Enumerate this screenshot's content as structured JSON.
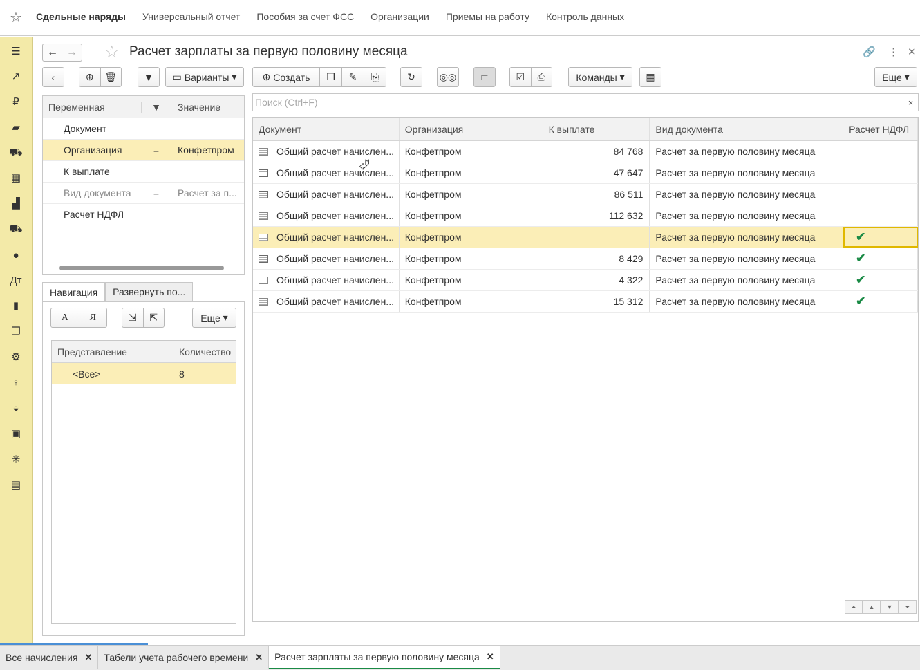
{
  "topnav": {
    "items": [
      "Сдельные наряды",
      "Универсальный отчет",
      "Пособия за счет ФСС",
      "Организации",
      "Приемы на работу",
      "Контроль данных"
    ]
  },
  "window": {
    "title": "Расчет зарплаты за первую половину месяца"
  },
  "toolbar": {
    "variants": "Варианты",
    "create": "Создать",
    "commands": "Команды",
    "more": "Еще"
  },
  "filter_panel": {
    "headers": [
      "Переменная",
      "Значение"
    ],
    "rows": [
      {
        "name": "Документ",
        "op": "",
        "value": ""
      },
      {
        "name": "Организация",
        "op": "=",
        "value": "Конфетпром"
      },
      {
        "name": "К выплате",
        "op": "",
        "value": ""
      },
      {
        "name": "Вид документа",
        "op": "=",
        "value": "Расчет за п..."
      },
      {
        "name": "Расчет НДФЛ",
        "op": "",
        "value": ""
      }
    ]
  },
  "tabs": {
    "nav": "Навигация",
    "expand": "Развернуть по..."
  },
  "nav_panel": {
    "a": "А",
    "ya": "Я",
    "more": "Еще",
    "headers": [
      "Представление",
      "Количество"
    ],
    "row": {
      "name": "<Все>",
      "count": "8"
    }
  },
  "search": {
    "placeholder": "Поиск (Ctrl+F)",
    "clear": "×"
  },
  "grid": {
    "headers": [
      "Документ",
      "Организация",
      "К выплате",
      "Вид документа",
      "Расчет НДФЛ"
    ],
    "rows": [
      {
        "doc": "Общий расчет начислен...",
        "org": "Конфетпром",
        "pay": "84 768",
        "kind": "Расчет за первую половину месяца",
        "ndfl": "",
        "posted": false
      },
      {
        "doc": "Общий расчет начислен...",
        "org": "Конфетпром",
        "pay": "47 647",
        "kind": "Расчет за первую половину месяца",
        "ndfl": "",
        "posted": true
      },
      {
        "doc": "Общий расчет начислен...",
        "org": "Конфетпром",
        "pay": "86 511",
        "kind": "Расчет за первую половину месяца",
        "ndfl": "",
        "posted": true
      },
      {
        "doc": "Общий расчет начислен...",
        "org": "Конфетпром",
        "pay": "112 632",
        "kind": "Расчет за первую половину месяца",
        "ndfl": "",
        "posted": false
      },
      {
        "doc": "Общий расчет начислен...",
        "org": "Конфетпром",
        "pay": "",
        "kind": "Расчет за первую половину месяца",
        "ndfl": "✔",
        "posted": false
      },
      {
        "doc": "Общий расчет начислен...",
        "org": "Конфетпром",
        "pay": "8 429",
        "kind": "Расчет за первую половину месяца",
        "ndfl": "✔",
        "posted": true
      },
      {
        "doc": "Общий расчет начислен...",
        "org": "Конфетпром",
        "pay": "4 322",
        "kind": "Расчет за первую половину месяца",
        "ndfl": "✔",
        "posted": false
      },
      {
        "doc": "Общий расчет начислен...",
        "org": "Конфетпром",
        "pay": "15 312",
        "kind": "Расчет за первую половину месяца",
        "ndfl": "✔",
        "posted": false
      }
    ]
  },
  "bottom_tabs": [
    "Все начисления",
    "Табели учета рабочего времени",
    "Расчет зарплаты за первую половину месяца"
  ],
  "colors": {
    "accent": "#f3eaa8",
    "selection": "#fbeeb7",
    "check": "#1a8a45"
  }
}
